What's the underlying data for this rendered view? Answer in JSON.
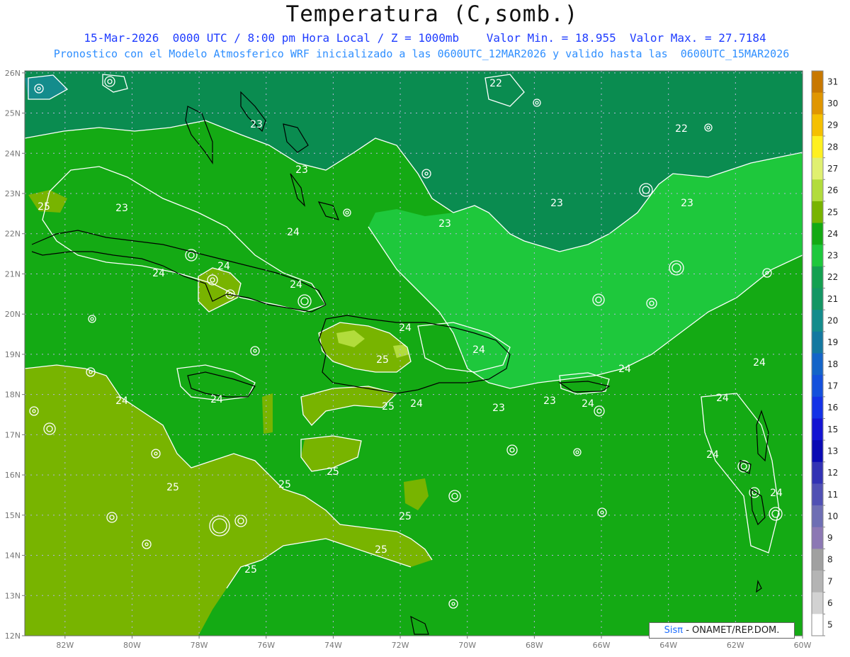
{
  "header": {
    "title": "Temperatura (C,somb.)",
    "subtitle1": "15-Mar-2026  0000 UTC / 8:00 pm Hora Local / Z = 1000mb    Valor Min. = 18.955  Valor Max. = 27.7184",
    "subtitle2": "Pronostico con el Modelo Atmosferico WRF inicializado a las 0600UTC_12MAR2026 y valido hasta las  0600UTC_15MAR2026"
  },
  "axes": {
    "lat_labels": [
      "26N",
      "25N",
      "24N",
      "23N",
      "22N",
      "21N",
      "20N",
      "19N",
      "18N",
      "17N",
      "16N",
      "15N",
      "14N",
      "13N",
      "12N"
    ],
    "lon_labels": [
      "82W",
      "80W",
      "78W",
      "76W",
      "74W",
      "72W",
      "70W",
      "68W",
      "66W",
      "64W",
      "62W",
      "60W"
    ]
  },
  "colorbar": {
    "labels": [
      "31",
      "30",
      "29",
      "28",
      "27",
      "26",
      "25",
      "24",
      "23",
      "22",
      "21",
      "20",
      "19",
      "18",
      "17",
      "16",
      "15",
      "13",
      "12",
      "11",
      "10",
      "9",
      "8",
      "7",
      "6",
      "5"
    ],
    "colors": [
      "#c87800",
      "#e09600",
      "#f5c000",
      "#fff020",
      "#e0f070",
      "#b2dc3c",
      "#78b400",
      "#14aa14",
      "#1ec83c",
      "#14a050",
      "#149664",
      "#148c8c",
      "#1478a0",
      "#1464c8",
      "#1450dc",
      "#1432e6",
      "#1414d2",
      "#0a0ab4",
      "#3232b4",
      "#5050b4",
      "#6e6eb4",
      "#8c78b4",
      "#a0a0a0",
      "#b4b4b4",
      "#d2d2d2",
      "#ffffff"
    ]
  },
  "map_fills": {
    "north_dark": "#0a8c50",
    "mid_green": "#14aa14",
    "light_green": "#1ec83c",
    "olive": "#78b400",
    "warm": "#b2dc3c",
    "contour": "#ffffff",
    "coast": "#000000",
    "grid": "#b4b4dc"
  },
  "contour_labels": [
    {
      "t": "22"
    },
    {
      "t": "22"
    },
    {
      "t": "23"
    },
    {
      "t": "23"
    },
    {
      "t": "23"
    },
    {
      "t": "23"
    },
    {
      "t": "23"
    },
    {
      "t": "24"
    },
    {
      "t": "24"
    },
    {
      "t": "24"
    },
    {
      "t": "24"
    },
    {
      "t": "24"
    },
    {
      "t": "24"
    },
    {
      "t": "24"
    },
    {
      "t": "23"
    },
    {
      "t": "24"
    },
    {
      "t": "24"
    },
    {
      "t": "24"
    },
    {
      "t": "23"
    },
    {
      "t": "24"
    },
    {
      "t": "24"
    },
    {
      "t": "24"
    },
    {
      "t": "24"
    },
    {
      "t": "24"
    },
    {
      "t": "25"
    },
    {
      "t": "25"
    },
    {
      "t": "25"
    },
    {
      "t": "25"
    },
    {
      "t": "25"
    },
    {
      "t": "25"
    },
    {
      "t": "25"
    },
    {
      "t": "25"
    },
    {
      "t": "25"
    },
    {
      "t": "23"
    }
  ],
  "credit": {
    "sis": "Sisπ",
    "rest": "- ONAMET/REP.DOM."
  }
}
